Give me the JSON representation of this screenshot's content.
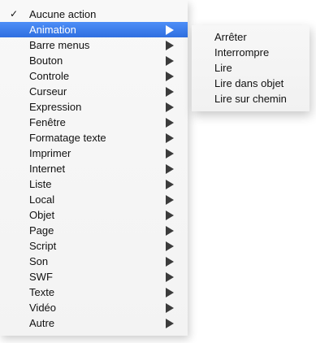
{
  "menu": {
    "items": [
      {
        "label": "Aucune action",
        "checked": true,
        "has_submenu": false,
        "selected": false
      },
      {
        "label": "Animation",
        "checked": false,
        "has_submenu": true,
        "selected": true
      },
      {
        "label": "Barre menus",
        "checked": false,
        "has_submenu": true,
        "selected": false
      },
      {
        "label": "Bouton",
        "checked": false,
        "has_submenu": true,
        "selected": false
      },
      {
        "label": "Controle",
        "checked": false,
        "has_submenu": true,
        "selected": false
      },
      {
        "label": "Curseur",
        "checked": false,
        "has_submenu": true,
        "selected": false
      },
      {
        "label": "Expression",
        "checked": false,
        "has_submenu": true,
        "selected": false
      },
      {
        "label": "Fenêtre",
        "checked": false,
        "has_submenu": true,
        "selected": false
      },
      {
        "label": "Formatage texte",
        "checked": false,
        "has_submenu": true,
        "selected": false
      },
      {
        "label": "Imprimer",
        "checked": false,
        "has_submenu": true,
        "selected": false
      },
      {
        "label": "Internet",
        "checked": false,
        "has_submenu": true,
        "selected": false
      },
      {
        "label": "Liste",
        "checked": false,
        "has_submenu": true,
        "selected": false
      },
      {
        "label": "Local",
        "checked": false,
        "has_submenu": true,
        "selected": false
      },
      {
        "label": "Objet",
        "checked": false,
        "has_submenu": true,
        "selected": false
      },
      {
        "label": "Page",
        "checked": false,
        "has_submenu": true,
        "selected": false
      },
      {
        "label": "Script",
        "checked": false,
        "has_submenu": true,
        "selected": false
      },
      {
        "label": "Son",
        "checked": false,
        "has_submenu": true,
        "selected": false
      },
      {
        "label": "SWF",
        "checked": false,
        "has_submenu": true,
        "selected": false
      },
      {
        "label": "Texte",
        "checked": false,
        "has_submenu": true,
        "selected": false
      },
      {
        "label": "Vidéo",
        "checked": false,
        "has_submenu": true,
        "selected": false
      },
      {
        "label": "Autre",
        "checked": false,
        "has_submenu": true,
        "selected": false
      }
    ],
    "check_glyph": "✓"
  },
  "submenu": {
    "items": [
      {
        "label": "Arrêter"
      },
      {
        "label": "Interrompre"
      },
      {
        "label": "Lire"
      },
      {
        "label": "Lire dans objet"
      },
      {
        "label": "Lire sur chemin"
      }
    ]
  },
  "colors": {
    "highlight": "#3b7ff0",
    "menu_background": "#f5f5f5",
    "text": "#111111"
  }
}
